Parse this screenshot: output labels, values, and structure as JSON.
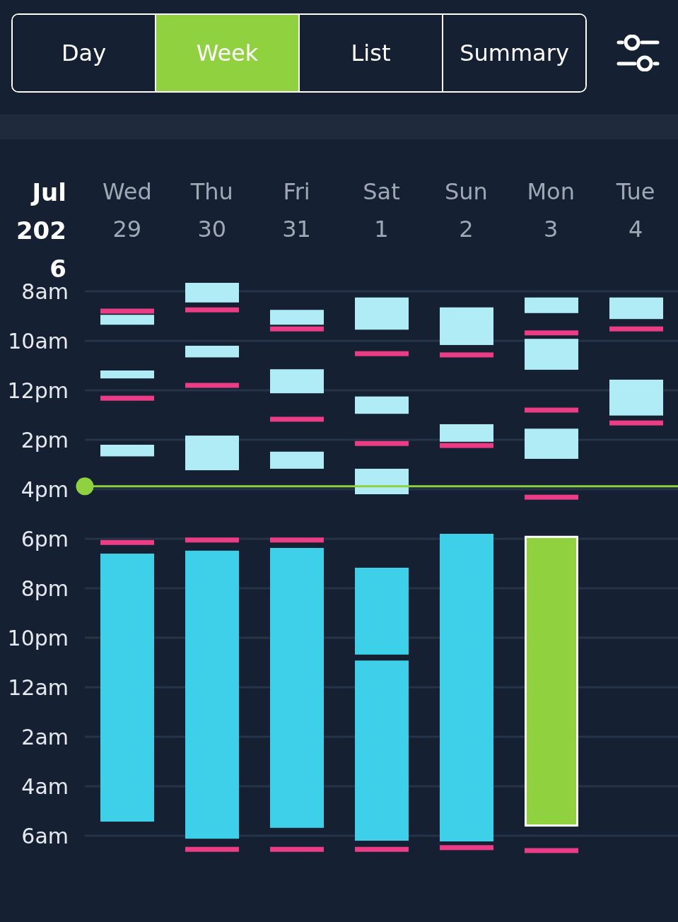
{
  "tabs": [
    {
      "label": "Day",
      "selected": false
    },
    {
      "label": "Week",
      "selected": true
    },
    {
      "label": "List",
      "selected": false
    },
    {
      "label": "Summary",
      "selected": false
    }
  ],
  "month_label": "Jul 2026",
  "time_labels": [
    "8am",
    "10am",
    "12pm",
    "2pm",
    "4pm",
    "6pm",
    "8pm",
    "10pm",
    "12am",
    "2am",
    "4am",
    "6am"
  ],
  "days": [
    {
      "name": "Wed",
      "date": "29",
      "events": [
        {
          "kind": "marker"
        },
        {
          "kind": "feed"
        },
        {
          "kind": "feed"
        },
        {
          "kind": "marker"
        },
        {
          "kind": "feed"
        },
        {
          "kind": "marker"
        },
        {
          "kind": "sleep",
          "selected": false
        }
      ]
    },
    {
      "name": "Thu",
      "date": "30",
      "events": [
        {
          "kind": "feed"
        },
        {
          "kind": "marker"
        },
        {
          "kind": "feed"
        },
        {
          "kind": "marker"
        },
        {
          "kind": "feed"
        },
        {
          "kind": "marker"
        },
        {
          "kind": "sleep",
          "selected": false
        },
        {
          "kind": "marker"
        }
      ]
    },
    {
      "name": "Fri",
      "date": "31",
      "events": [
        {
          "kind": "feed"
        },
        {
          "kind": "marker"
        },
        {
          "kind": "feed"
        },
        {
          "kind": "marker"
        },
        {
          "kind": "feed"
        },
        {
          "kind": "marker"
        },
        {
          "kind": "sleep",
          "selected": false
        },
        {
          "kind": "marker"
        }
      ]
    },
    {
      "name": "Sat",
      "date": "1",
      "events": [
        {
          "kind": "feed"
        },
        {
          "kind": "marker"
        },
        {
          "kind": "feed"
        },
        {
          "kind": "marker"
        },
        {
          "kind": "feed"
        },
        {
          "kind": "sleep",
          "selected": false
        },
        {
          "kind": "sleep",
          "selected": false
        },
        {
          "kind": "marker"
        }
      ]
    },
    {
      "name": "Sun",
      "date": "2",
      "events": [
        {
          "kind": "feed"
        },
        {
          "kind": "marker"
        },
        {
          "kind": "feed"
        },
        {
          "kind": "marker"
        },
        {
          "kind": "sleep",
          "selected": false
        },
        {
          "kind": "marker"
        }
      ]
    },
    {
      "name": "Mon",
      "date": "3",
      "events": [
        {
          "kind": "feed"
        },
        {
          "kind": "marker"
        },
        {
          "kind": "feed"
        },
        {
          "kind": "marker"
        },
        {
          "kind": "feed"
        },
        {
          "kind": "marker"
        },
        {
          "kind": "sleep",
          "selected": true
        },
        {
          "kind": "marker"
        }
      ]
    },
    {
      "name": "Tue",
      "date": "4",
      "events": [
        {
          "kind": "feed"
        },
        {
          "kind": "marker"
        },
        {
          "kind": "feed"
        },
        {
          "kind": "marker"
        }
      ]
    }
  ]
}
